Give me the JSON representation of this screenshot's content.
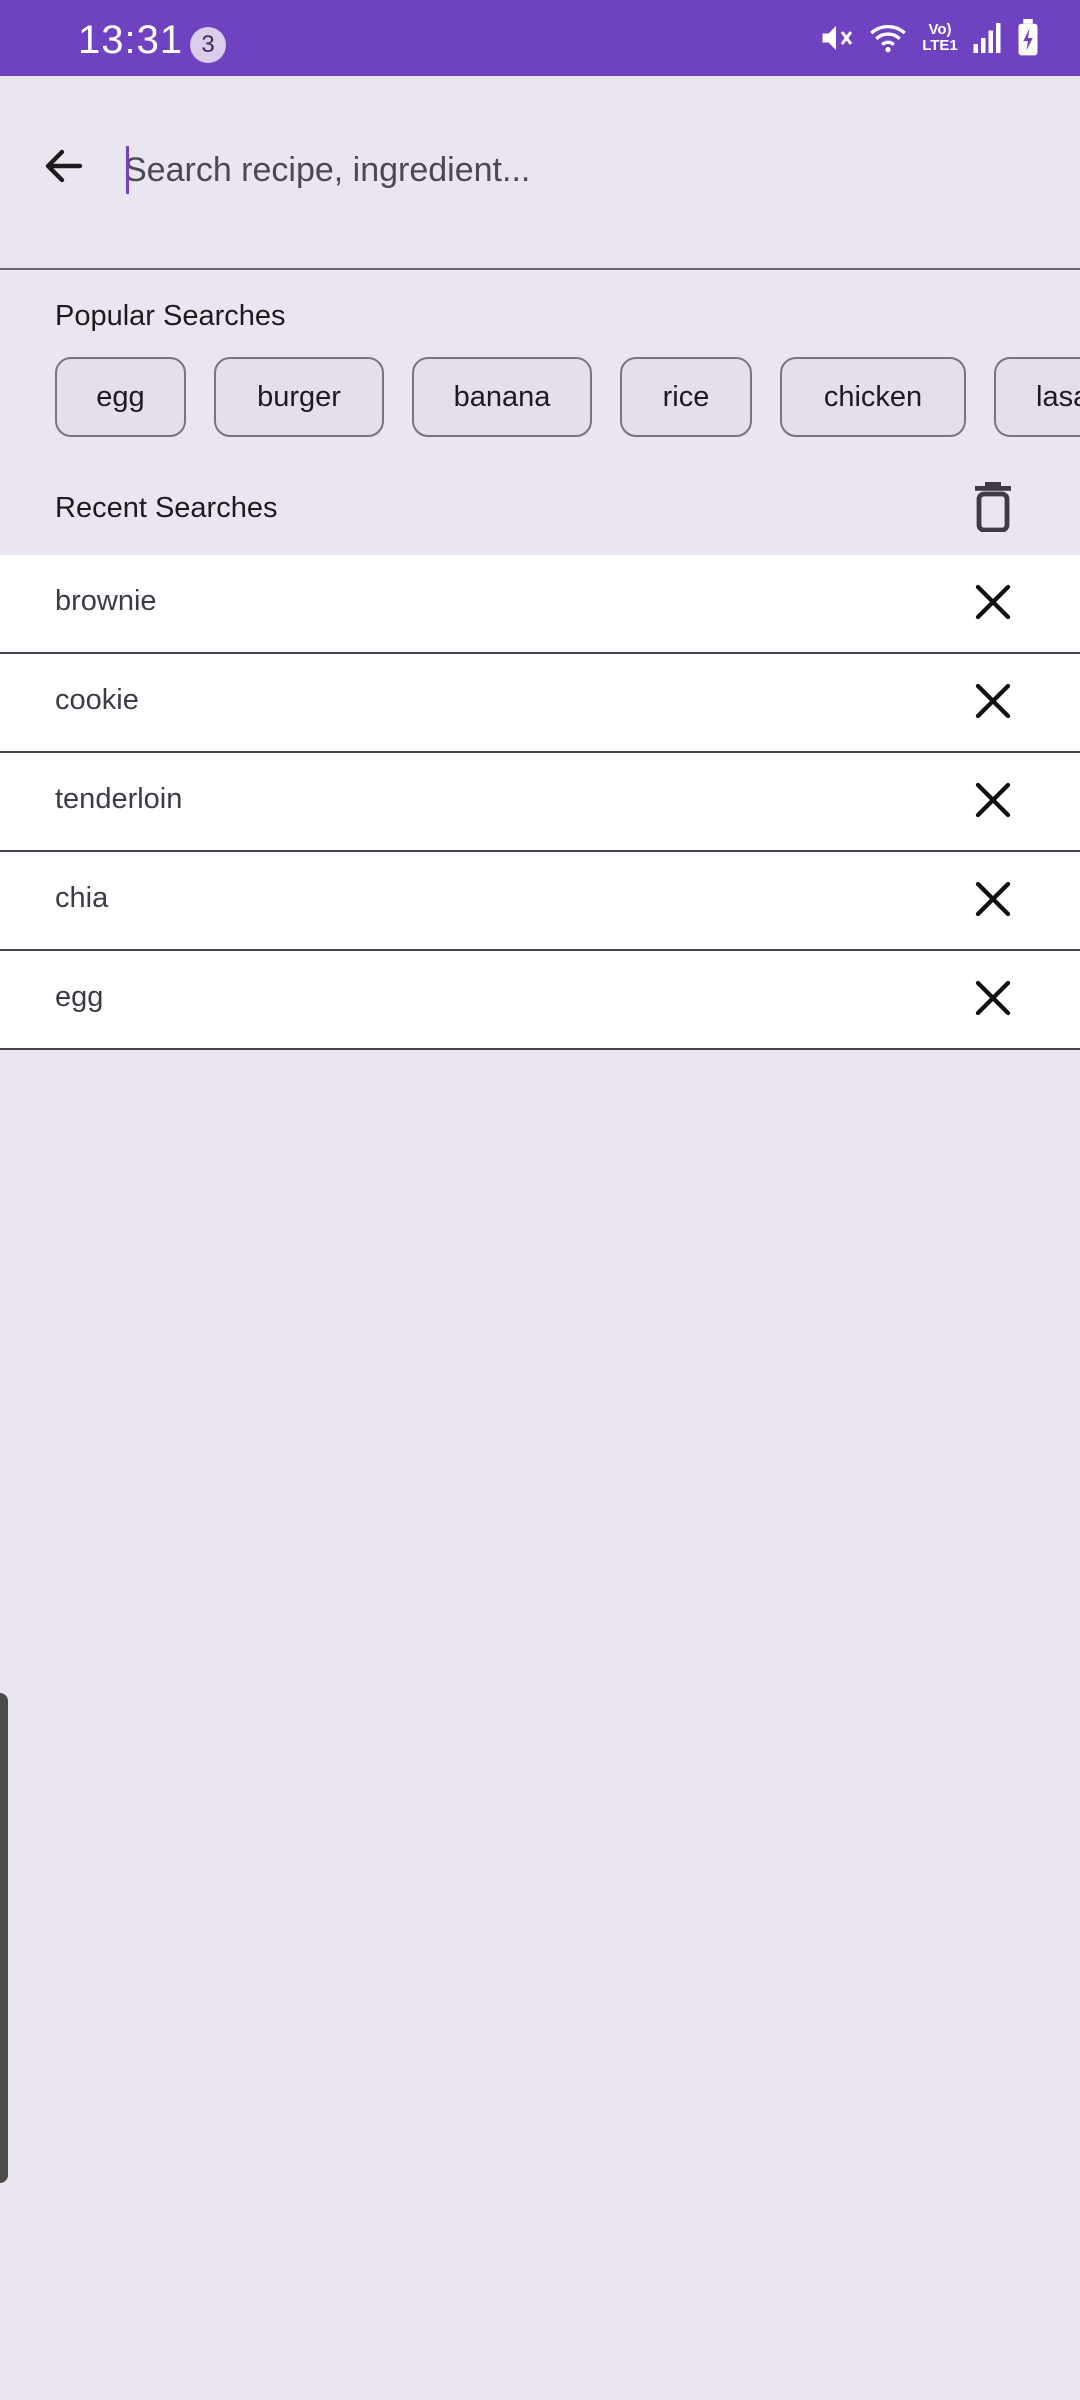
{
  "status_bar": {
    "time": "13:31",
    "notification_count": "3",
    "network_label": "Vo) LTE1",
    "bg_color": "#6f42c1"
  },
  "search": {
    "placeholder": "Search recipe, ingredient..."
  },
  "popular": {
    "title": "Popular Searches",
    "chips": [
      "egg",
      "burger",
      "banana",
      "rice",
      "chicken",
      "lasa"
    ]
  },
  "recent": {
    "title": "Recent Searches",
    "items": [
      "brownie",
      "cookie",
      "tenderloin",
      "chia",
      "egg"
    ]
  },
  "icons": {
    "back": "arrow-left-icon",
    "clear_all": "trash-icon",
    "remove": "close-icon"
  }
}
